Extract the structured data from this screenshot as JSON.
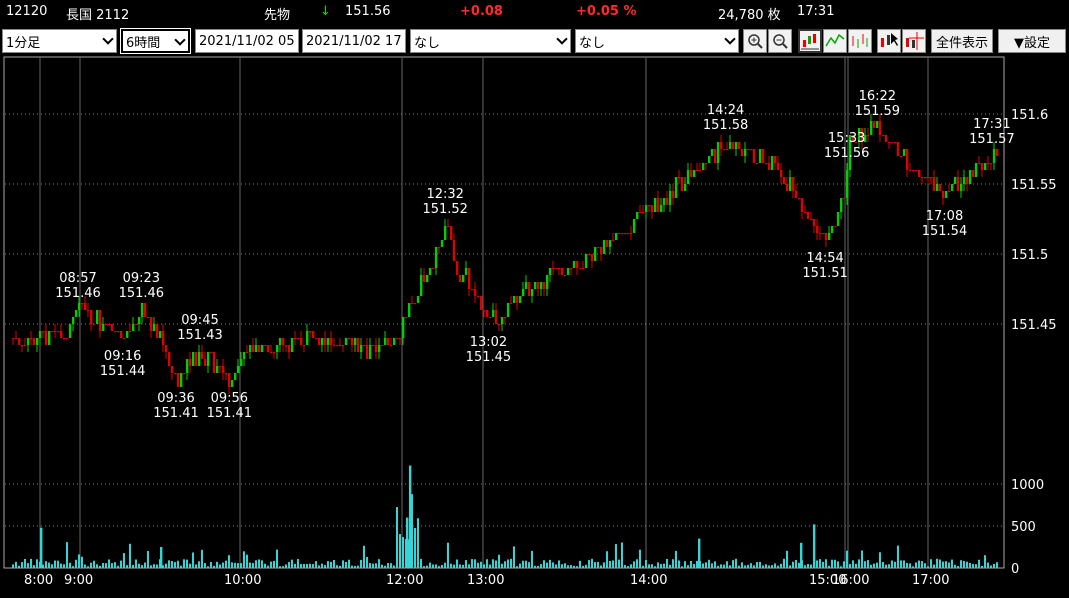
{
  "header": {
    "code": "12120",
    "name": "長国 2112",
    "market": "先物",
    "direction_arrow": "↓",
    "price": "151.56",
    "change": "+0.08",
    "change_pct": "+0.05 %",
    "volume": "24,780 枚",
    "time": "17:31"
  },
  "toolbar": {
    "interval": "1分足",
    "span": "6時間",
    "date_from": "2021/11/02 05",
    "date_to": "2021/11/02 17",
    "indicator_1": "なし",
    "indicator_2": "なし",
    "show_all_label": "全件表示",
    "settings_label": "▼設定",
    "icons": [
      "zoom-in-icon",
      "zoom-out-icon",
      "candle-chart-icon",
      "line-chart-icon",
      "bar-chart-icon",
      "cursor-icon",
      "crosshair-icon"
    ]
  },
  "colors": {
    "up": "#00d000",
    "down": "#e00000",
    "volume": "#33d6d6",
    "grid": "#808080",
    "price_change": "#ff2a2a",
    "arrow": "#21d021"
  },
  "chart_data": {
    "type": "candlestick",
    "price_ylim": [
      151.4,
      151.62
    ],
    "price_ticks": [
      "151.6",
      "151.55",
      "151.5",
      "151.45"
    ],
    "volume_ylim": [
      0,
      1200
    ],
    "volume_ticks": [
      "1000",
      "500",
      "0"
    ],
    "x_ticks": [
      "8:00",
      "9:00",
      "10:00",
      "12:00",
      "13:00",
      "14:00",
      "15:00",
      "16:00",
      "17:00"
    ],
    "annotations": [
      {
        "time": "08:57",
        "price": "151.46"
      },
      {
        "time": "09:23",
        "price": "151.46"
      },
      {
        "time": "09:16",
        "price": "151.44"
      },
      {
        "time": "09:45",
        "price": "151.43"
      },
      {
        "time": "09:36",
        "price": "151.41"
      },
      {
        "time": "09:56",
        "price": "151.41"
      },
      {
        "time": "12:32",
        "price": "151.52"
      },
      {
        "time": "13:02",
        "price": "151.45"
      },
      {
        "time": "14:24",
        "price": "151.58"
      },
      {
        "time": "15:33",
        "price": "151.56"
      },
      {
        "time": "14:54",
        "price": "151.51"
      },
      {
        "time": "16:22",
        "price": "151.59"
      },
      {
        "time": "17:08",
        "price": "151.54"
      },
      {
        "time": "17:31",
        "price": "151.57"
      }
    ],
    "price_path": [
      [
        "8:00",
        151.44
      ],
      [
        "8:30",
        151.44
      ],
      [
        "8:45",
        151.45
      ],
      [
        "8:57",
        151.46
      ],
      [
        "9:05",
        151.455
      ],
      [
        "9:16",
        151.44
      ],
      [
        "9:23",
        151.46
      ],
      [
        "9:30",
        151.44
      ],
      [
        "9:36",
        151.41
      ],
      [
        "9:45",
        151.43
      ],
      [
        "9:56",
        151.41
      ],
      [
        "10:05",
        151.43
      ],
      [
        "10:30",
        151.435
      ],
      [
        "11:00",
        151.44
      ],
      [
        "11:30",
        151.43
      ],
      [
        "11:55",
        151.44
      ],
      [
        "12:10",
        151.47
      ],
      [
        "12:32",
        151.52
      ],
      [
        "12:40",
        151.49
      ],
      [
        "12:50",
        151.48
      ],
      [
        "13:02",
        151.45
      ],
      [
        "13:20",
        151.48
      ],
      [
        "13:40",
        151.5
      ],
      [
        "14:00",
        151.53
      ],
      [
        "14:10",
        151.55
      ],
      [
        "14:24",
        151.58
      ],
      [
        "14:40",
        151.56
      ],
      [
        "14:54",
        151.51
      ],
      [
        "15:00",
        151.545
      ],
      [
        "15:10",
        151.55
      ],
      [
        "15:33",
        151.56
      ],
      [
        "16:00",
        151.58
      ],
      [
        "16:22",
        151.59
      ],
      [
        "16:40",
        151.57
      ],
      [
        "17:08",
        151.54
      ],
      [
        "17:20",
        151.56
      ],
      [
        "17:31",
        151.57
      ]
    ]
  }
}
